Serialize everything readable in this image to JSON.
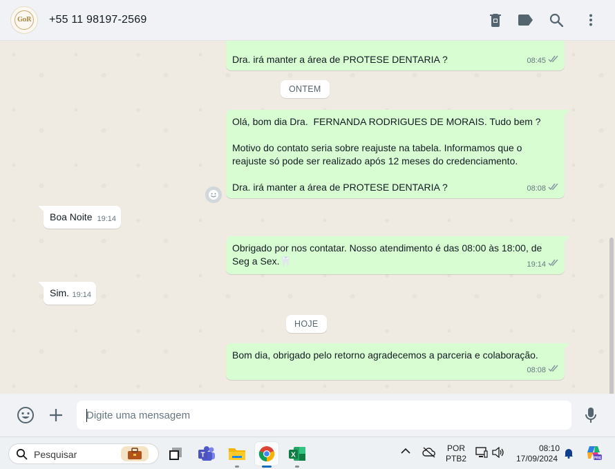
{
  "header": {
    "avatar_text": "GoR",
    "contact_name": "+55 11 98197-2569",
    "icons": [
      "delete-icon",
      "label-icon",
      "search-icon",
      "menu-icon"
    ]
  },
  "messages": [
    {
      "id": "m1",
      "dir": "out",
      "text": "Dra. irá manter a área de PROTESE DENTARIA ?",
      "time": "08:45",
      "status": "read"
    },
    {
      "id": "d1",
      "type": "date",
      "label": "ONTEM"
    },
    {
      "id": "m2",
      "dir": "out",
      "text": "Olá, bom dia Dra.  FERNANDA RODRIGUES DE MORAIS. Tudo bem ?\n\nMotivo do contato seria sobre reajuste na tabela. Informamos que o reajuste só pode ser realizado após 12 meses do credenciamento.\n\nDra. irá manter a área de PROTESE DENTARIA ?",
      "time": "08:08",
      "status": "read"
    },
    {
      "id": "m3",
      "dir": "in",
      "text": "Boa Noite",
      "time": "19:14"
    },
    {
      "id": "m4",
      "dir": "out",
      "text": "Obrigado por nos contatar. Nosso atendimento é das 08:00 às 18:00, de Seg a Sex.",
      "emoji": "🦷",
      "time": "19:14",
      "status": "read"
    },
    {
      "id": "m5",
      "dir": "in",
      "text": "Sim.",
      "time": "19:14"
    },
    {
      "id": "d2",
      "type": "date",
      "label": "HOJE"
    },
    {
      "id": "m6",
      "dir": "out",
      "text": "Bom dia, obrigado pelo retorno agradecemos a parceria e colaboração.",
      "time": "08:08",
      "status": "read"
    }
  ],
  "composer": {
    "placeholder": "Digite uma mensagem",
    "value": ""
  },
  "taskbar": {
    "search_label": "Pesquisar",
    "apps": [
      "task-view",
      "teams",
      "file-explorer",
      "chrome",
      "excel"
    ],
    "active_app": "chrome",
    "lang_line1": "POR",
    "lang_line2": "PTB2",
    "time": "08:10",
    "date": "17/09/2024"
  },
  "colors": {
    "outgoing_bubble": "#d9fdd3",
    "incoming_bubble": "#ffffff",
    "chat_bg": "#efeae2",
    "read_tick": "#8696a0"
  }
}
